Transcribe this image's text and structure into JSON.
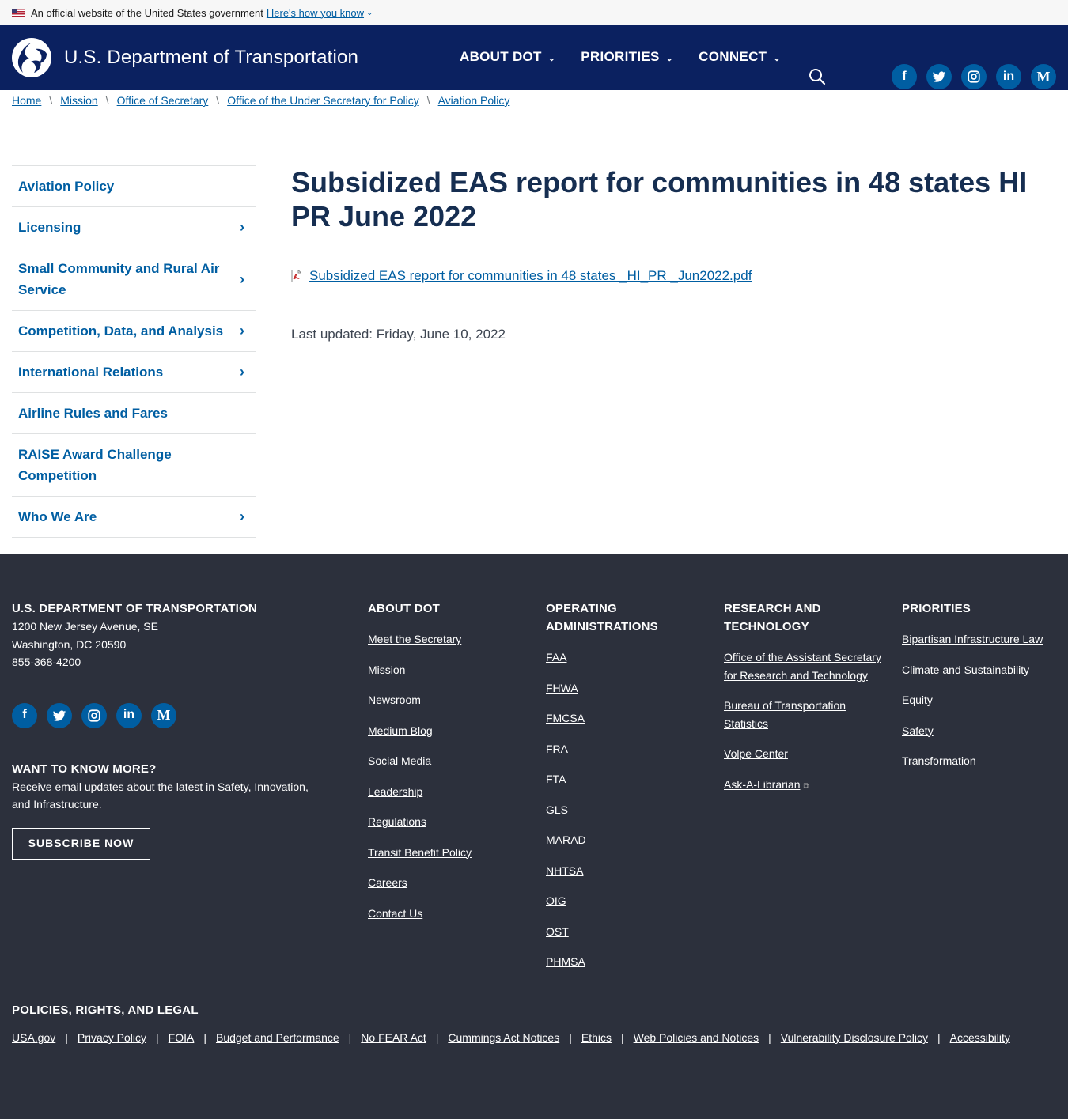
{
  "gov_banner": {
    "text": "An official website of the United States government",
    "link": "Here's how you know"
  },
  "header": {
    "logo_text": "U.S. Department of Transportation",
    "nav": [
      {
        "label": "ABOUT DOT"
      },
      {
        "label": "PRIORITIES"
      },
      {
        "label": "CONNECT"
      }
    ],
    "social": [
      "facebook-icon",
      "twitter-icon",
      "instagram-icon",
      "linkedin-icon",
      "medium-icon"
    ]
  },
  "breadcrumb": [
    "Home",
    "Mission",
    "Office of Secretary",
    "Office of the Under Secretary for Policy",
    "Aviation Policy"
  ],
  "sidebar": {
    "items": [
      {
        "label": "Aviation Policy",
        "has_children": false
      },
      {
        "label": "Licensing",
        "has_children": true
      },
      {
        "label": "Small Community and Rural Air Service",
        "has_children": true
      },
      {
        "label": "Competition, Data, and Analysis",
        "has_children": true
      },
      {
        "label": "International Relations",
        "has_children": true
      },
      {
        "label": "Airline Rules and Fares",
        "has_children": false
      },
      {
        "label": "RAISE Award Challenge Competition",
        "has_children": false
      },
      {
        "label": "Who We Are",
        "has_children": true
      }
    ]
  },
  "main": {
    "title": "Subsidized EAS report for communities in 48 states HI PR June 2022",
    "file_link": "Subsidized EAS report for communities in 48 states _HI_PR _Jun2022.pdf",
    "last_updated": "Last updated: Friday, June 10, 2022"
  },
  "footer": {
    "dot": {
      "heading": "U.S. DEPARTMENT OF TRANSPORTATION",
      "address1": "1200 New Jersey Avenue, SE",
      "address2": "Washington, DC 20590",
      "phone": "855-368-4200"
    },
    "want": {
      "heading": "WANT TO KNOW MORE?",
      "text": "Receive email updates about the latest in Safety, Innovation, and Infrastructure.",
      "button": "SUBSCRIBE NOW"
    },
    "about": {
      "heading": "ABOUT DOT",
      "links": [
        "Meet the Secretary",
        "Mission",
        "Newsroom",
        "Medium Blog",
        "Social Media",
        "Leadership",
        "Regulations",
        "Transit Benefit Policy",
        "Careers",
        "Contact Us"
      ]
    },
    "operating": {
      "heading": "OPERATING ADMINISTRATIONS",
      "links": [
        "FAA",
        "FHWA",
        "FMCSA",
        "FRA",
        "FTA",
        "GLS",
        "MARAD",
        "NHTSA",
        "OIG",
        "OST",
        "PHMSA"
      ]
    },
    "research": {
      "heading": "RESEARCH AND TECHNOLOGY",
      "links": [
        "Office of the Assistant Secretary for Research and Technology",
        "Bureau of Transportation Statistics",
        "Volpe Center",
        "Ask-A-Librarian"
      ]
    },
    "priorities": {
      "heading": "PRIORITIES",
      "links": [
        "Bipartisan Infrastructure Law",
        "Climate and Sustainability",
        "Equity",
        "Safety",
        "Transformation"
      ]
    },
    "policies": {
      "heading": "POLICIES, RIGHTS, AND LEGAL",
      "links": [
        "USA.gov",
        "Privacy Policy",
        "FOIA",
        "Budget and Performance",
        "No FEAR Act",
        "Cummings Act Notices",
        "Ethics",
        "Web Policies and Notices",
        "Vulnerability Disclosure Policy",
        "Accessibility"
      ]
    }
  }
}
